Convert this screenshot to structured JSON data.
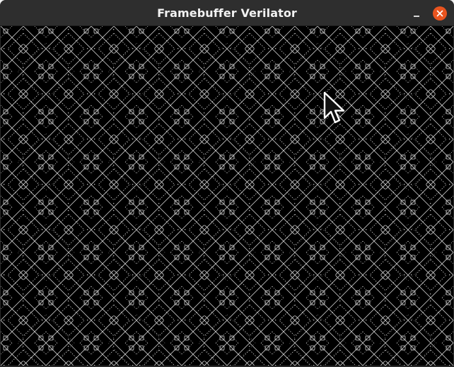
{
  "window": {
    "title": "Framebuffer Verilator",
    "controls": {
      "minimize_icon": "minimize-icon",
      "close_icon": "close-icon"
    }
  },
  "framebuffer": {
    "content": "diagonal-pattern",
    "background_color": "#000000",
    "pattern_color": "#d8d8d8"
  },
  "cursor": {
    "icon": "arrow-cursor-icon"
  },
  "colors": {
    "titlebar": "#2e2e2e",
    "title_text": "#f2f2f2",
    "close_button": "#e9541f"
  }
}
